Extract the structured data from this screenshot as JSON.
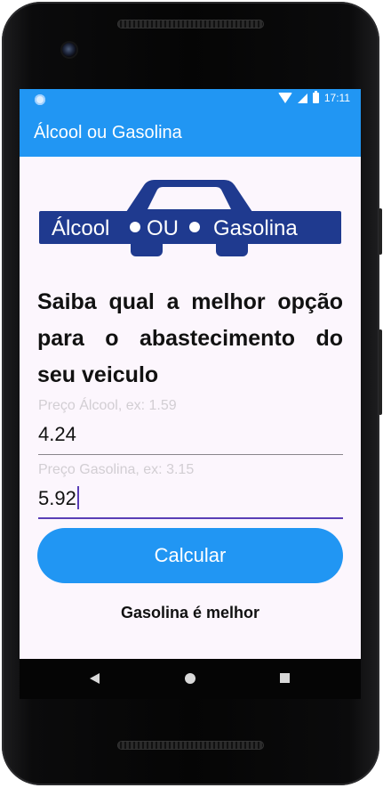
{
  "status_bar": {
    "time": "17:11",
    "icons": [
      "notification-dot-icon",
      "wifi-icon",
      "signal-icon",
      "battery-icon"
    ]
  },
  "app_bar": {
    "title": "Álcool ou Gasolina"
  },
  "logo": {
    "text_left": "Álcool",
    "text_middle": "OU",
    "text_right": "Gasolina",
    "color": "#1f3a8f"
  },
  "headline": "Saiba qual a melhor opção para o abastecimento do seu veiculo",
  "form": {
    "alcohol_field": {
      "placeholder": "Preço Álcool, ex: 1.59",
      "value": "4.24"
    },
    "gas_field": {
      "placeholder": "Preço Gasolina, ex: 3.15",
      "value": "5.92"
    },
    "calculate_label": "Calcular"
  },
  "result_text": "Gasolina é melhor",
  "colors": {
    "primary": "#2196f3",
    "background": "#fcf6fd",
    "focus_underline": "#5a3eb6",
    "hint": "#d2ced3",
    "logo_blue": "#1f3a8f"
  },
  "nav_bar": {
    "icons": [
      "back-icon",
      "home-icon",
      "recents-icon"
    ]
  }
}
